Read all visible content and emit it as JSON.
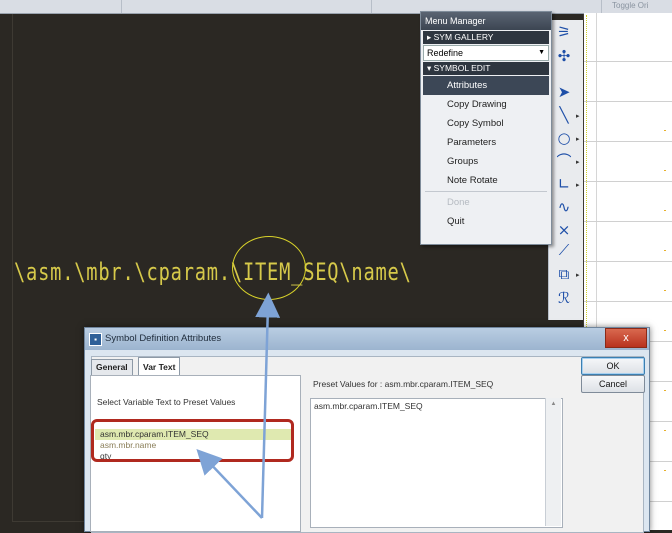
{
  "top_bar": {
    "toggle_label": "Toggle Ori"
  },
  "menu_manager": {
    "title": "Menu Manager",
    "sym_gallery": "SYM GALLERY",
    "redefine": "Redefine",
    "symbol_edit": "SYMBOL EDIT",
    "items": [
      "Attributes",
      "Copy Drawing",
      "Copy Symbol",
      "Parameters",
      "Groups",
      "Note Rotate"
    ],
    "done": "Done",
    "quit": "Quit"
  },
  "canvas": {
    "symbol_text": "\\asm.\\mbr.\\cparam.\\ITEM_SEQ\\name\\"
  },
  "dialog": {
    "title": "Symbol Definition Attributes",
    "close_label": "x",
    "tabs": [
      "General",
      "Var Text"
    ],
    "select_label": "Select Variable Text to Preset Values",
    "var_list": [
      "asm.mbr.cparam.ITEM_SEQ",
      "asm.mbr.name",
      "qty"
    ],
    "preset_label": "Preset Values for :  asm.mbr.cparam.ITEM_SEQ",
    "preset_values": [
      "asm.mbr.cparam.ITEM_SEQ"
    ],
    "ok": "OK",
    "cancel": "Cancel"
  },
  "colors": {
    "canvas_bg": "#2b2823",
    "annotation_text": "#d6c94a",
    "highlight_red": "#b0291f",
    "arrow_blue": "#7ea3d6"
  }
}
